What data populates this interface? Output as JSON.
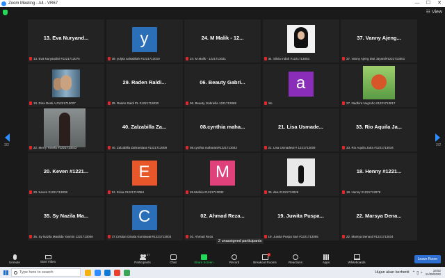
{
  "titlebar": {
    "title": "Zoom Meeting - A4 - VR67",
    "minimize": "—",
    "maximize": "☐",
    "close": "✕"
  },
  "view": {
    "label": "☷ View"
  },
  "pager": {
    "left": "2/2",
    "right": "2/2"
  },
  "tiles": [
    {
      "display": "13. Eva Nuryand...",
      "label": "13. Eva Nuryandini #1221713075"
    },
    {
      "letter": "y",
      "color": "#2a6fb8",
      "label": "39. yulyta salsabilah #1221713019"
    },
    {
      "display": "24. M Malik - 12...",
      "label": "24. M Malik - 1221713031"
    },
    {
      "photo": "hijab",
      "label": "34. Silvia Indah #1221713003"
    },
    {
      "display": "37. Vanny Ajeng...",
      "label": "37. Vanny Ajeng Dwi Jayanti#1221713001"
    },
    {
      "photo": "selfie",
      "label": "10. Dina Resti A #1221713027"
    },
    {
      "display": "29. Raden Raldi...",
      "label": "29. Raden Raldi PL #1221713030"
    },
    {
      "display": "06. Beauty Gabri...",
      "label": "06. Beauty Gabriella 1221713065"
    },
    {
      "letter": "a",
      "color": "#8a2db8",
      "label": "tito"
    },
    {
      "photo": "anime",
      "label": "27. Nadhira Nugroho #1221713017"
    },
    {
      "photo": "woman",
      "label": "22. Merry Yosefa #1221713022"
    },
    {
      "display": "40. Zalzabilla Za...",
      "label": "40. Zalzabilla Zahrantiara #1221713009"
    },
    {
      "display": "08.cynthia maha...",
      "label": "08.cynthia maharani#1221713042"
    },
    {
      "display": "21. Lisa Usmade...",
      "label": "21. Lisa Usmadewi # 1221713028"
    },
    {
      "display": "33. Rio Aquila Ja...",
      "label": "33. Rio Aquila Jatra #1221713034"
    },
    {
      "display": "20. Keven #1221...",
      "label": "20. Keven #1221713038"
    },
    {
      "letter": "E",
      "color": "#e8572a",
      "label": "12. Erisa #1221713064"
    },
    {
      "letter": "M",
      "color": "#e0417a",
      "label": "26.Muthia #1221713032"
    },
    {
      "photo": "dance",
      "label": "09. dea #1221713029"
    },
    {
      "display": "18. Henny #1221...",
      "label": "18. Henny #1221713078"
    },
    {
      "display": "35. Sy Nazila Ma...",
      "label": "35. Sy Nazila Maulida Yasmin 1221713059"
    },
    {
      "letter": "C",
      "color": "#2a6fb8",
      "label": "07.Cristian Dinata Kurniawan#1221713003"
    },
    {
      "display": "02. Ahmad Reza...",
      "label": "02. Ahmad Reza"
    },
    {
      "display": "19. Juwita Puspa...",
      "label": "19. Juwita Puspa Sari #1221713055"
    },
    {
      "display": "22. Marsya Dena...",
      "label": "22. Marsya Denaoil #1221713024"
    }
  ],
  "toast": "2 unassigned participants",
  "toolbar": {
    "unmute": "Unmute",
    "start_video": "Start Video",
    "participants": "Participants",
    "participants_count": "37",
    "chat": "Chat",
    "share_screen": "Share Screen",
    "record": "Record",
    "breakout": "Breakout Rooms",
    "reactions": "Reactions",
    "apps": "Apps",
    "whiteboards": "Whiteboards",
    "leave": "Leave Room"
  },
  "taskbar": {
    "search_placeholder": "Type here to search",
    "weather": "Hujan akan berhenti",
    "time": "18:52",
    "date": "11/28/2022"
  }
}
